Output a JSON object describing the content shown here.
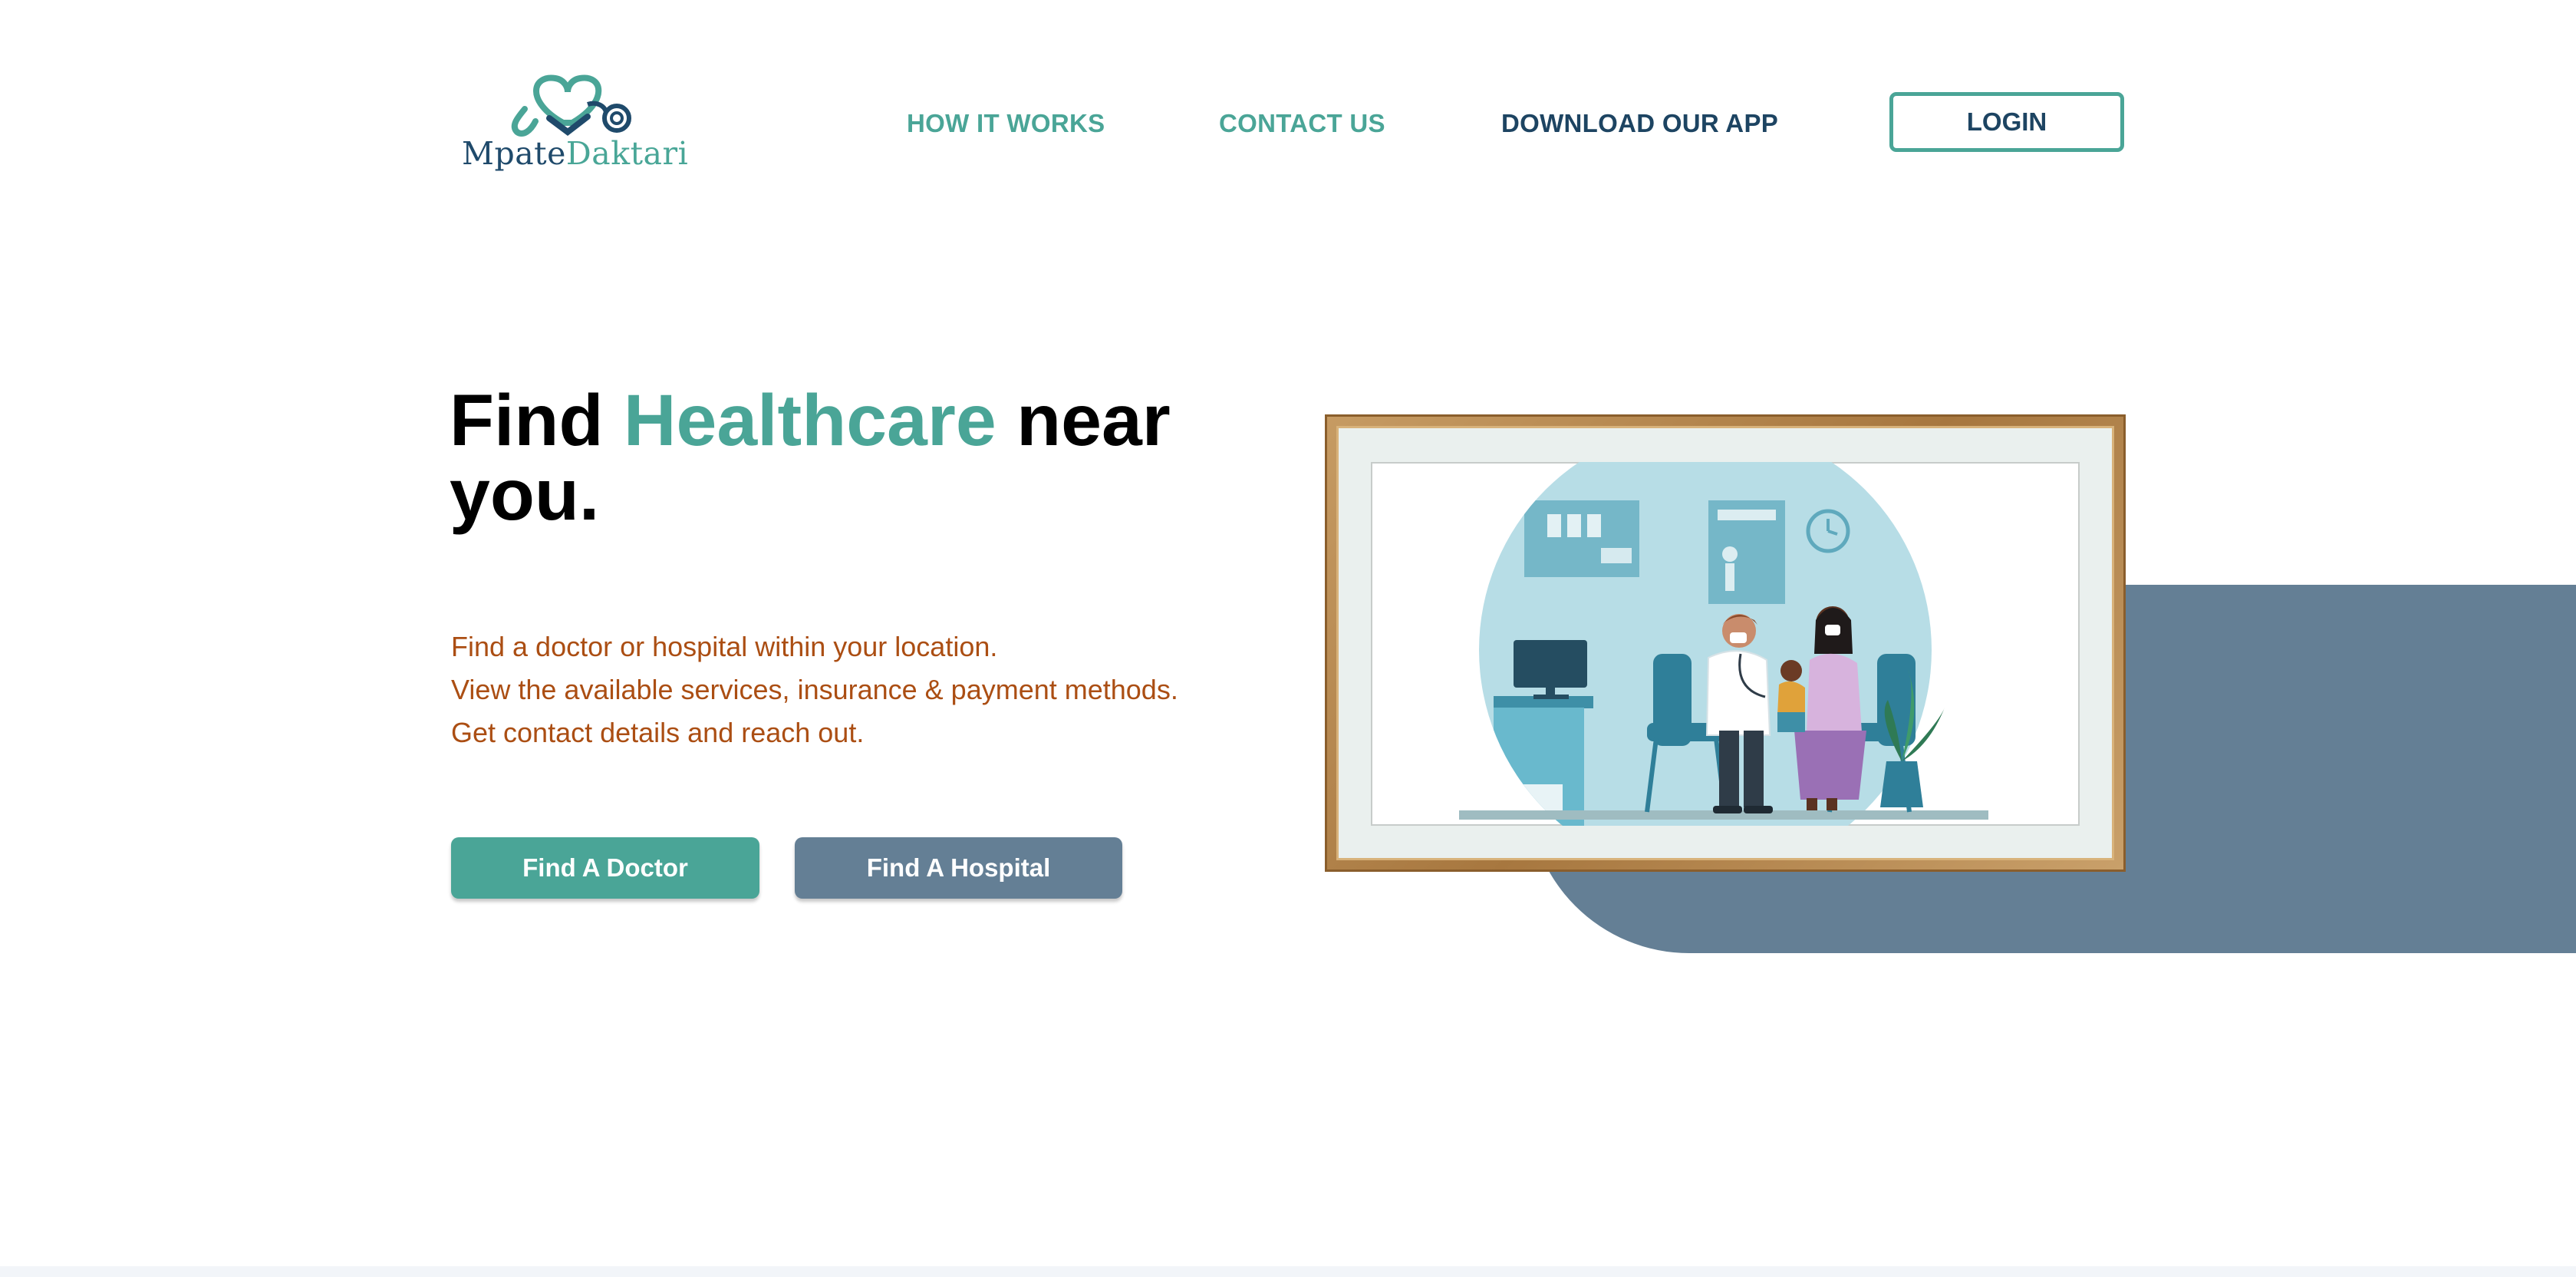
{
  "header": {
    "logo": {
      "part_a": "Mpate",
      "part_b": "Daktari"
    },
    "nav": {
      "how_it_works": "HOW IT WORKS",
      "contact_us": "CONTACT US",
      "download_app": "DOWNLOAD OUR APP"
    },
    "login_label": "LOGIN"
  },
  "hero": {
    "title_part1": "Find ",
    "title_accent": "Healthcare",
    "title_part2": " near you.",
    "description": [
      "Find a doctor or hospital within your location.",
      "View the available services, insurance & payment methods.",
      "Get contact details and reach out."
    ],
    "buttons": {
      "find_doctor": "Find A Doctor",
      "find_hospital": "Find A Hospital"
    }
  },
  "illustration": {
    "subject": "doctor examining child held by mother in clinic"
  },
  "colors": {
    "primary_teal": "#4aa597",
    "navy": "#1d4462",
    "slate": "#647f95",
    "description_text": "#ab4e13"
  }
}
